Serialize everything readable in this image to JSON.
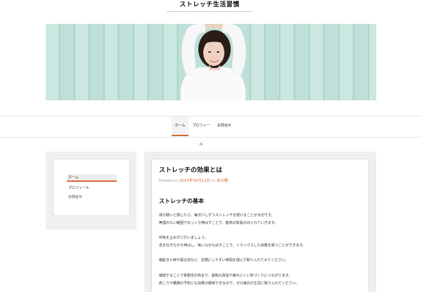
{
  "site": {
    "title": "ストレッチ生活習慣"
  },
  "nav": {
    "items": [
      "ホーム",
      "プロフィール",
      "お問合せ"
    ],
    "active_index": 0
  },
  "sidebar": {
    "items": [
      "ホーム",
      "プロフィール",
      "お問合せ"
    ],
    "active_index": 0
  },
  "article": {
    "title": "ストレッチの効果とは",
    "meta": {
      "posted_on": "Posted on",
      "date": "2015年05月12日",
      "in": "in",
      "category": "未分類"
    },
    "subtitle": "ストレッチの基本",
    "body": [
      "体が硬いと感じたら、毎日少しずつストレッチを続けることが大切です。",
      "無理のない範囲でゆっくり伸ばすことで、筋肉の緊張がほぐれていきます。",
      "",
      "呼吸を止めずに行いましょう。",
      "息を吐きながら伸ばし、吸いながら戻すことで、リラックスした状態を保つことができます。",
      "",
      "朝起きた時や寝る前など、習慣にしやすい時間を選んで取り入れてみてください。",
      "",
      "継続することで柔軟性が高まり、姿勢の改善や疲れにくい体づくりにつながります。",
      "肩こりや腰痛の予防にも効果が期待できるので、ぜひ毎日の生活に取り入れてください。"
    ]
  },
  "colors": {
    "accent": "#d96a3a",
    "panel": "#f0efee",
    "border": "#dcdcdc"
  }
}
